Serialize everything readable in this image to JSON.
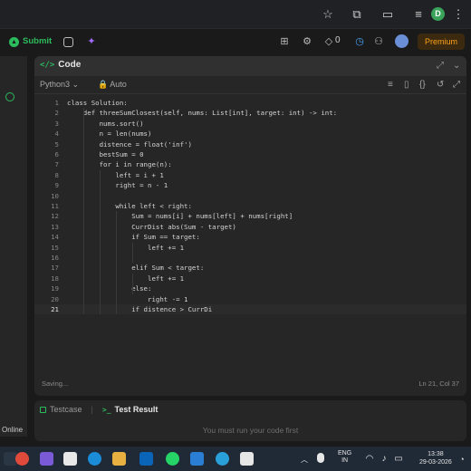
{
  "topnav": {
    "submit_label": "Submit",
    "streak_count": "0",
    "premium_label": "Premium"
  },
  "chrome": {
    "profile_initial": "D"
  },
  "left_panel": {
    "status_label": "Online"
  },
  "code_panel": {
    "title": "Code",
    "title_icon": "</>",
    "language": "Python3",
    "autocomplete": "Auto",
    "status_text": "Saving...",
    "cursor_position": "Ln 21, Col 37",
    "lines": [
      {
        "n": "1",
        "text": "class Solution:"
      },
      {
        "n": "2",
        "text": "    def threeSumClosest(self, nums: List[int], target: int) -> int:"
      },
      {
        "n": "3",
        "text": "        nums.sort()"
      },
      {
        "n": "4",
        "text": "        n = len(nums)"
      },
      {
        "n": "5",
        "text": "        distence = float('inf')"
      },
      {
        "n": "6",
        "text": "        bestSum = 0"
      },
      {
        "n": "7",
        "text": "        for i in range(n):"
      },
      {
        "n": "8",
        "text": "            left = i + 1"
      },
      {
        "n": "9",
        "text": "            right = n - 1"
      },
      {
        "n": "10",
        "text": ""
      },
      {
        "n": "11",
        "text": "            while left < right:"
      },
      {
        "n": "12",
        "text": "                Sum = nums[i] + nums[left] + nums[right]"
      },
      {
        "n": "13",
        "text": "                CurrDist abs(Sum - target)"
      },
      {
        "n": "14",
        "text": "                if Sum == target:"
      },
      {
        "n": "15",
        "text": "                    left += 1"
      },
      {
        "n": "16",
        "text": ""
      },
      {
        "n": "17",
        "text": "                elif Sum < target:"
      },
      {
        "n": "18",
        "text": "                    left += 1"
      },
      {
        "n": "19",
        "text": "                else:"
      },
      {
        "n": "20",
        "text": "                    right -= 1"
      },
      {
        "n": "21",
        "text": "                if distence > CurrDi"
      }
    ]
  },
  "test_panel": {
    "tab_testcase": "Testcase",
    "tab_result": "Test Result",
    "message": "You must run your code first"
  },
  "taskbar": {
    "language": "ENG",
    "region": "IN",
    "time": "13:38",
    "date": "29-03-2026"
  }
}
